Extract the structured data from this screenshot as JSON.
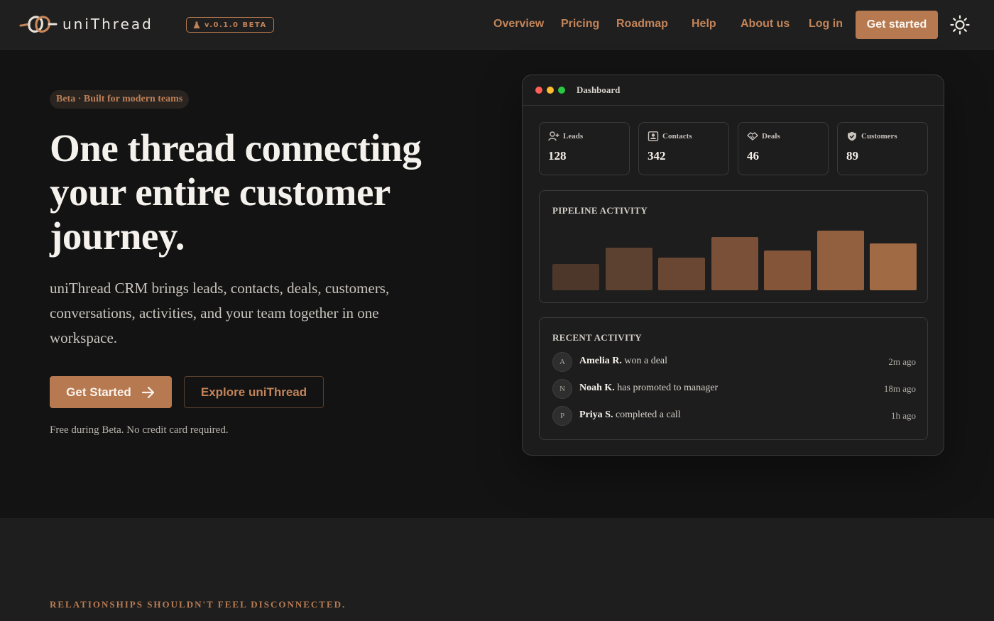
{
  "nav": {
    "brand": "uniThread",
    "version_badge": "v.0.1.0 BETA",
    "links": [
      "Overview",
      "Pricing",
      "Roadmap",
      "Help",
      "About us",
      "Log in"
    ],
    "cta": "Get started"
  },
  "hero": {
    "pill": "Beta · Built for modern teams",
    "title": "One thread connecting your entire customer journey.",
    "subtitle": "uniThread CRM brings leads, contacts, deals, customers, conversations, activities, and your team together in one workspace.",
    "primary_button": "Get Started",
    "secondary_button": "Explore uniThread",
    "note": "Free during Beta. No credit card required."
  },
  "dashboard": {
    "title": "Dashboard",
    "stats": [
      {
        "label": "Leads",
        "value": "128",
        "icon": "user-plus-icon"
      },
      {
        "label": "Contacts",
        "value": "342",
        "icon": "contact-card-icon"
      },
      {
        "label": "Deals",
        "value": "46",
        "icon": "handshake-icon"
      },
      {
        "label": "Customers",
        "value": "89",
        "icon": "shield-check-icon"
      }
    ],
    "pipeline_title": "PIPELINE ACTIVITY",
    "pipeline_values": [
      34,
      56,
      43,
      70,
      52,
      78,
      61
    ],
    "pipeline_max": 80,
    "pipeline_colors": [
      "#4d362a",
      "#5c4030",
      "#6a4733",
      "#7a5038",
      "#85553a",
      "#93603f",
      "#a06a45"
    ],
    "recent_title": "RECENT ACTIVITY",
    "activity": [
      {
        "initial": "A",
        "name": "Amelia R.",
        "action": "won a deal",
        "time": "2m ago"
      },
      {
        "initial": "N",
        "name": "Noah K.",
        "action": "has promoted to manager",
        "time": "18m ago"
      },
      {
        "initial": "P",
        "name": "Priya S.",
        "action": "completed a call",
        "time": "1h ago"
      }
    ]
  },
  "section2": {
    "eyebrow": "RELATIONSHIPS SHOULDN'T FEEL DISCONNECTED."
  },
  "colors": {
    "accent": "#b7794f",
    "accent_text": "#c38459",
    "background": "#131313",
    "nav_background": "#1f1f1f",
    "traffic_red": "#ff5f57",
    "traffic_yellow": "#febc2e",
    "traffic_green": "#28c840"
  }
}
